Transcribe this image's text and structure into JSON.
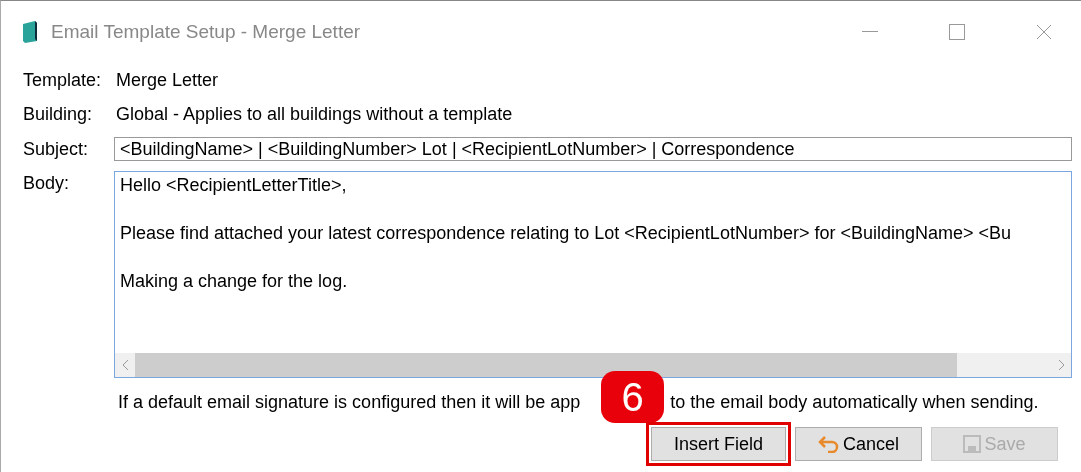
{
  "window": {
    "title": "Email Template Setup - Merge Letter"
  },
  "fields": [
    {
      "label": "Template:",
      "value": "Merge Letter",
      "kind": "text"
    },
    {
      "label": "Building:",
      "value": "Global - Applies to all buildings without a template",
      "kind": "text"
    },
    {
      "label": "Subject:",
      "value": "<BuildingName> | <BuildingNumber> Lot | <RecipientLotNumber> | Correspondence",
      "kind": "input"
    }
  ],
  "body": {
    "label": "Body:",
    "paragraphs": [
      "Hello <RecipientLetterTitle>,",
      "Please find attached your latest correspondence relating to Lot <RecipientLotNumber> for <BuildingName> <Bu",
      "Making a change for the log."
    ]
  },
  "note": [
    "If a default email signature is configured then it will be app",
    "to the email body automatically when sending."
  ],
  "callout": {
    "number": "6"
  },
  "buttons": [
    {
      "label": "Insert Field",
      "kind": "insert",
      "disabled": false,
      "highlighted": true
    },
    {
      "label": "Cancel",
      "kind": "cancel",
      "disabled": false,
      "highlighted": false
    },
    {
      "label": "Save",
      "kind": "save",
      "disabled": true,
      "highlighted": false
    }
  ]
}
